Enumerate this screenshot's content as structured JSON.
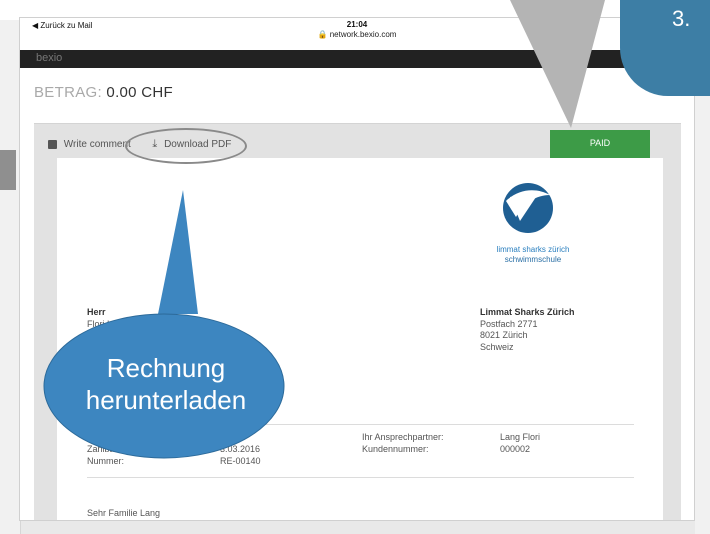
{
  "status_bar": {
    "back": "◀ Zurück zu Mail",
    "time": "21:04",
    "url": "🔒 network.bexio.com"
  },
  "navbar": {
    "brand": "bexio"
  },
  "amount": {
    "label": "BETRAG:",
    "value": "0.00 CHF"
  },
  "toolbar": {
    "write_comment": "Write comment",
    "download_pdf": "Download PDF"
  },
  "status_badge": "PAID",
  "logo": {
    "line1": "limmat sharks zürich",
    "line2": "schwimmschule"
  },
  "recipient": {
    "salutation": "Herr",
    "name_partial": "Flori L"
  },
  "sender": {
    "name": "Limmat Sharks Zürich",
    "line1": "Postfach 2771",
    "line2": "8021 Zürich",
    "line3": "Schweiz"
  },
  "details": {
    "left": [
      {
        "label": "D",
        "value": ""
      },
      {
        "label": "Zahlbar bis:",
        "value": "3.03.2016"
      },
      {
        "label": "Nummer:",
        "value": "RE-00140"
      }
    ],
    "right": [
      {
        "label": "Ihr Ansprechpartner:",
        "value": "Lang Flori"
      },
      {
        "label": "Kundennummer:",
        "value": "000002"
      }
    ]
  },
  "letter_greeting": "Sehr Familie Lang",
  "annotations": {
    "step": "3.",
    "callout_line1": "Rechnung",
    "callout_line2": "herunterladen"
  },
  "colors": {
    "paid": "#3d9b47",
    "callout": "#3d86c0",
    "badge": "#3d7ea5",
    "navbar": "#222222"
  }
}
